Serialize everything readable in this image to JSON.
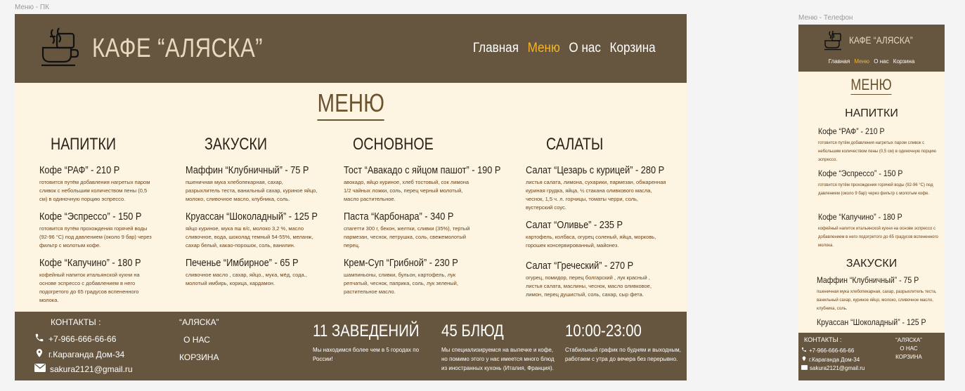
{
  "frames": {
    "desktop_label": "Меню - ПК",
    "phone_label": "Меню - Телефон"
  },
  "brand": "КАФЕ “АЛЯСКА”",
  "nav": [
    {
      "label": "Главная",
      "active": false
    },
    {
      "label": "Меню",
      "active": true
    },
    {
      "label": "О нас",
      "active": false
    },
    {
      "label": "Корзина",
      "active": false
    }
  ],
  "menu_title": "МЕНЮ",
  "columns": [
    {
      "title": "НАПИТКИ",
      "items": [
        {
          "name": "Кофе “РАФ” - 210 Р",
          "desc": "готовится путём добавления нагретых паром сливок с небольшим количеством пены (0,5 см) в одиночную порцию эспрессо."
        },
        {
          "name": "Кофе “Эспрессо” - 150 Р",
          "desc": "готовится путём прохождения горячей воды (92-96 °C) под давлением (около 9 бар) через фильтр с молотым кофе."
        },
        {
          "name": "Кофе “Капучино” - 180 Р",
          "desc": "кофейный напиток итальянской кухни на основе эспрессо с добавлением в него подогретого до 65 градусов вспененного молока."
        }
      ]
    },
    {
      "title": "ЗАКУСКИ",
      "items": [
        {
          "name": "Маффин “Клубничный” - 75 Р",
          "desc": "пшеничная мука хлебопекарная, сахар, разрыхлитель теста, ванильный сахар, куриное яйцо, молоко, сливочное масло, клубника, соль."
        },
        {
          "name": "Круассан “Шоколадный” - 125 Р",
          "desc": "яйцо куриное, мука пш в/с, молоко 3,2 %, масло сливочное, вода, шоколад темный 54-55%, меланж, сахар белый, какао-порошок, соль, ванилин."
        },
        {
          "name": "Печенье “Имбирное” - 65 Р",
          "desc": "сливочное масло , сахар, яйцо., мука, мёд, сода., молотый имбирь, корица, кардамон."
        }
      ]
    },
    {
      "title": "ОСНОВНОЕ",
      "items": [
        {
          "name": "Тост “Авакадо с яйцом пашот” - 190 Р",
          "desc": "авокадо, яйцо куриное, хлеб тостовый, сок лимона 1/2 чайных ложки, соль, перец черный молотый, масло растительное."
        },
        {
          "name": "Паста “Карбонара” - 340 Р",
          "desc": "спагетти 300 г, бекон, желтки, сливки (35%), тертый пармезан, чеснок, петрушка, соль, свежемолотый перец."
        },
        {
          "name": "Крем-Суп “Грибной” - 230 Р",
          "desc": "шампиньоны, сливки, бульон, картофель, лук репчатый, чеснок, паприка, соль, лук зеленый, растительное масло."
        }
      ]
    },
    {
      "title": "САЛАТЫ",
      "items": [
        {
          "name": "Салат “Цезарь с курицей” - 280 Р",
          "desc": "листья салата, лимона, сухарики, пармезан, обжаренная куриная грудка, яйца, ½ стакана оливкового масла, чеснок, 1,5 ч. л. горчицы, томаты черри, соль, вустерский соус."
        },
        {
          "name": "Салат “Оливье” - 235 Р",
          "desc": "картофель, колбаса, огурец соленый, яйца, морковь, горошек консервированный, майонез."
        },
        {
          "name": "Салат “Греческий” - 270 Р",
          "desc": "огурец, помидор, перец болгарский , лук красный , листья салата, маслины, чеснок, масло оливковое, лимон, перец душистый, соль, сахар, сыр фета."
        }
      ]
    }
  ],
  "footer": {
    "contacts_title": "КОНТАКТЫ :",
    "phone": "+7-966-666-66-66",
    "address": "г.Караганда Дом-34",
    "email": "sakura2121@gmail.ru",
    "links": [
      "“АЛЯСКА”",
      "О НАС",
      "КОРЗИНА"
    ],
    "stats": [
      {
        "big": "11 ЗАВЕДЕНИЙ",
        "small": "Мы находимся более чем в 5 городах по России!"
      },
      {
        "big": "45 БЛЮД",
        "small": "Мы специализируемся на выпечке и кофе, но помимо этого у нас имеется много блюд из иностранных кухонь (Италия, Франция)."
      },
      {
        "big": "10:00-23:00",
        "small": "Стабильный график по будням и выходным, работаем с утра до вечера без перерывно."
      }
    ]
  },
  "phone": {
    "sections": [
      "НАПИТКИ",
      "ЗАКУСКИ"
    ],
    "contacts_title": "КОНТАКТЫ :"
  },
  "colors": {
    "header_bg": "#66563f",
    "page_bg": "#fef4e2",
    "accent": "#f2b42e",
    "title": "#6a532f"
  }
}
